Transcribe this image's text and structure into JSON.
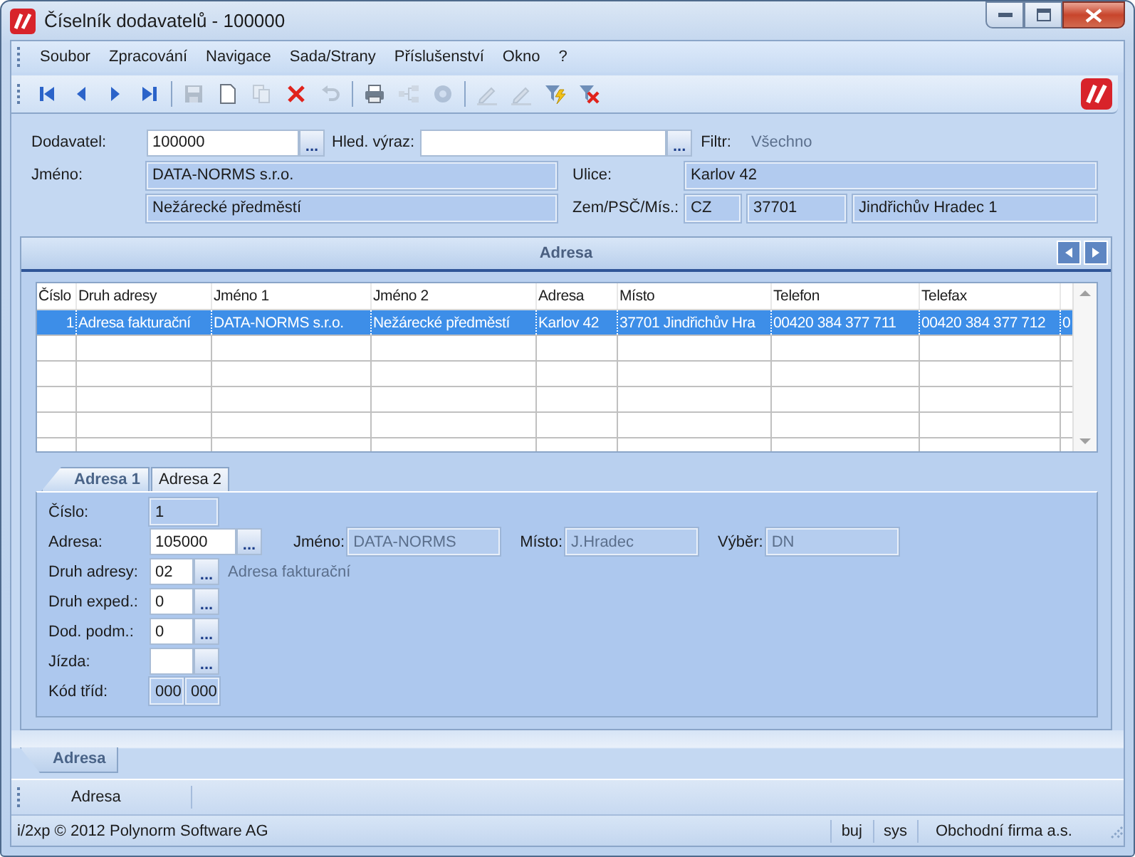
{
  "window": {
    "title": "Číselník dodavatelů - 100000"
  },
  "menu": [
    "Soubor",
    "Zpracování",
    "Navigace",
    "Sada/Strany",
    "Příslušenství",
    "Okno",
    "?"
  ],
  "toolbar": [
    {
      "kind": "first",
      "disabled": false
    },
    {
      "kind": "prev",
      "disabled": false
    },
    {
      "kind": "next",
      "disabled": false
    },
    {
      "kind": "last",
      "disabled": false
    },
    {
      "kind": "sep"
    },
    {
      "kind": "save",
      "disabled": true
    },
    {
      "kind": "new",
      "disabled": false
    },
    {
      "kind": "copy",
      "disabled": true
    },
    {
      "kind": "delete",
      "disabled": false
    },
    {
      "kind": "undo",
      "disabled": true
    },
    {
      "kind": "sep"
    },
    {
      "kind": "print",
      "disabled": false
    },
    {
      "kind": "tree",
      "disabled": true
    },
    {
      "kind": "gear",
      "disabled": true
    },
    {
      "kind": "sep"
    },
    {
      "kind": "pen",
      "disabled": true
    },
    {
      "kind": "pen",
      "disabled": true
    },
    {
      "kind": "filter",
      "disabled": false
    },
    {
      "kind": "filter-off",
      "disabled": false
    }
  ],
  "header": {
    "supplier": {
      "label": "Dodavatel:",
      "value": "100000",
      "lookup": "..."
    },
    "search": {
      "label": "Hled. výraz:",
      "lookup": "..."
    },
    "filter": {
      "label": "Filtr:",
      "value": "Všechno"
    },
    "name": {
      "label": "Jméno:",
      "line1": "DATA-NORMS s.r.o.",
      "line2": "Nežárecké předměstí"
    },
    "street": {
      "label": "Ulice:",
      "value": "Karlov 42"
    },
    "place": {
      "label": "Zem/PSČ/Mís.:",
      "country": "CZ",
      "zip": "37701",
      "city": "Jindřichův Hradec 1"
    }
  },
  "panel": {
    "title": "Adresa",
    "table": {
      "columns": [
        "Číslo",
        "Druh adresy",
        "Jméno 1",
        "Jméno 2",
        "Adresa",
        "Místo",
        "Telefon",
        "Telefax"
      ],
      "rows": [
        {
          "selected": true,
          "cells": [
            "1",
            "Adresa fakturační",
            "DATA-NORMS s.r.o.",
            "Nežárecké předměstí",
            "Karlov 42",
            "37701 Jindřichův Hra",
            "00420 384 377 711",
            "00420 384 377 712",
            "0"
          ]
        }
      ]
    },
    "tabs": [
      {
        "label": "Adresa 1",
        "selected": true
      },
      {
        "label": "Adresa 2",
        "selected": false
      }
    ],
    "form": [
      {
        "label": "Číslo:",
        "fields": [
          {
            "kind": "readonly",
            "value": "1"
          }
        ]
      },
      {
        "label": "Adresa:",
        "fields": [
          {
            "kind": "input",
            "value": "105000",
            "lookup": "..."
          },
          {
            "kind": "disabled",
            "label": "Jméno:",
            "value": "DATA-NORMS"
          },
          {
            "kind": "disabled",
            "label": "Místo:",
            "value": "J.Hradec"
          },
          {
            "kind": "disabled",
            "label": "Výběr:",
            "value": "DN"
          }
        ]
      },
      {
        "label": "Druh adresy:",
        "fields": [
          {
            "kind": "input",
            "value": "02",
            "lookup": "..."
          },
          {
            "kind": "note",
            "value": "Adresa fakturační"
          }
        ]
      },
      {
        "label": "Druh exped.:",
        "fields": [
          {
            "kind": "input",
            "value": "0",
            "lookup": "..."
          }
        ]
      },
      {
        "label": "Dod. podm.:",
        "fields": [
          {
            "kind": "input",
            "value": "0",
            "lookup": "..."
          }
        ]
      },
      {
        "label": "Jízda:",
        "fields": [
          {
            "kind": "input",
            "lookup": "..."
          }
        ]
      },
      {
        "label": "Kód tříd:",
        "fields": [
          {
            "kind": "readonly",
            "value": "000"
          },
          {
            "kind": "readonly",
            "value": "000"
          }
        ]
      }
    ]
  },
  "bottom_tabs": [
    {
      "label": "Adresa",
      "selected": true
    }
  ],
  "section_bar": {
    "label": "Adresa"
  },
  "status_bar": {
    "copyright": "i/2xp © 2012 Polynorm Software AG",
    "items": [
      "buj",
      "sys",
      "Obchodní firma a.s."
    ]
  }
}
